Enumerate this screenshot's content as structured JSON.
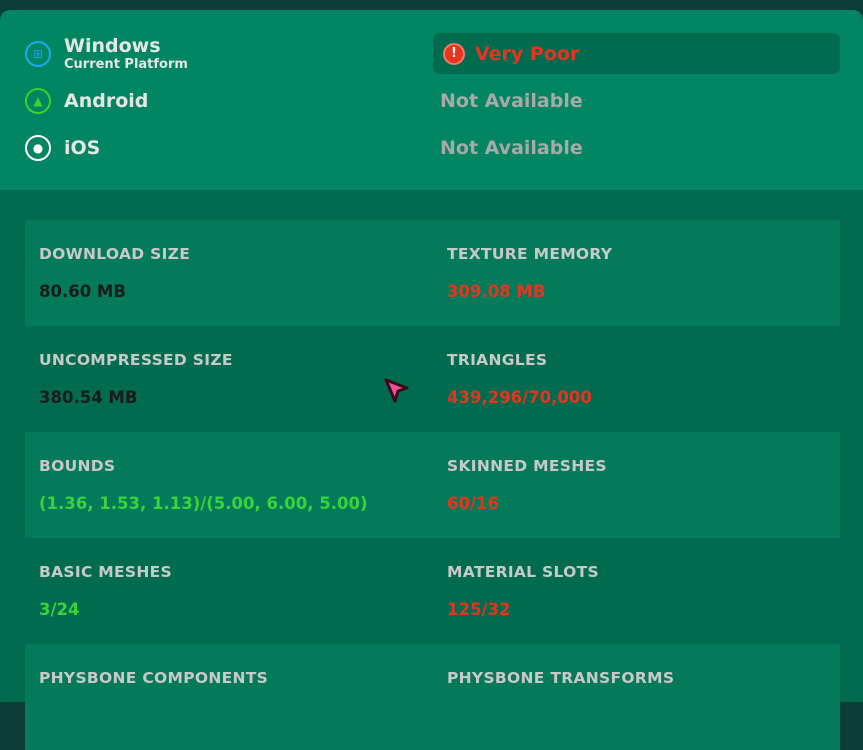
{
  "platforms": [
    {
      "name": "Windows",
      "sub": "Current Platform",
      "status": "Very Poor",
      "icon": "windows-icon"
    },
    {
      "name": "Android",
      "status": "Not Available",
      "icon": "android-icon"
    },
    {
      "name": "iOS",
      "status": "Not Available",
      "icon": "apple-icon"
    }
  ],
  "stats": [
    {
      "label": "DOWNLOAD SIZE",
      "value": "80.60 MB",
      "color": "dark"
    },
    {
      "label": "TEXTURE MEMORY",
      "value": "309.08 MB",
      "color": "red"
    },
    {
      "label": "UNCOMPRESSED SIZE",
      "value": "380.54 MB",
      "color": "dark"
    },
    {
      "label": "TRIANGLES",
      "value": "439,296/70,000",
      "color": "red"
    },
    {
      "label": "BOUNDS",
      "value": "(1.36, 1.53, 1.13)/(5.00, 6.00, 5.00)",
      "color": "green"
    },
    {
      "label": "SKINNED MESHES",
      "value": "60/16",
      "color": "red"
    },
    {
      "label": "BASIC MESHES",
      "value": "3/24",
      "color": "green"
    },
    {
      "label": "MATERIAL SLOTS",
      "value": "125/32",
      "color": "red"
    },
    {
      "label": "PHYSBONE COMPONENTS"
    },
    {
      "label": "PHYSBONE TRANSFORMS"
    }
  ],
  "colors": {
    "bad": "#e8341c",
    "good": "#39d43a",
    "panel": "#018562"
  }
}
